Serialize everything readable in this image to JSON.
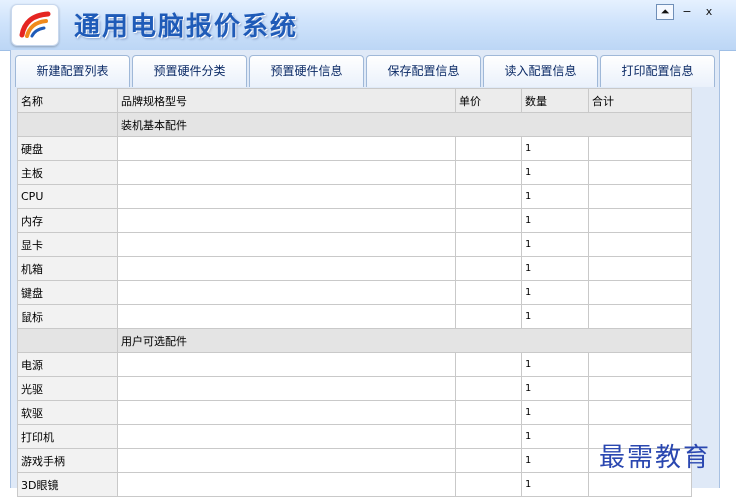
{
  "app": {
    "title": "通用电脑报价系统"
  },
  "window_buttons": [
    "⏶",
    "−",
    "x"
  ],
  "tabs": [
    "新建配置列表",
    "预置硬件分类",
    "预置硬件信息",
    "保存配置信息",
    "读入配置信息",
    "打印配置信息"
  ],
  "table": {
    "headers": [
      "名称",
      "品牌规格型号",
      "单价",
      "数量",
      "合计"
    ],
    "sections": [
      {
        "title": "装机基本配件",
        "items": [
          "硬盘",
          "主板",
          "CPU",
          "内存",
          "显卡",
          "机箱",
          "键盘",
          "鼠标"
        ]
      },
      {
        "title": "用户可选配件",
        "items": [
          "电源",
          "光驱",
          "软驱",
          "打印机",
          "游戏手柄",
          "3D眼镜"
        ]
      }
    ],
    "default_qty": "1"
  },
  "watermark": "最需教育",
  "colors": {
    "title": "#1f5bb8",
    "tab_text": "#0b2a66",
    "watermark": "#2a47b0"
  }
}
